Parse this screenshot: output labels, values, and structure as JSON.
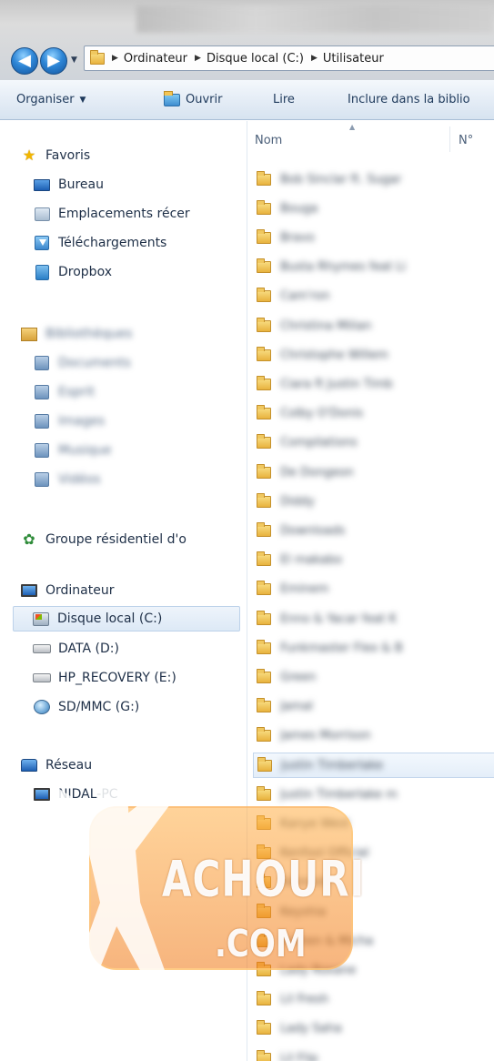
{
  "address_bar": {
    "crumbs": [
      "Ordinateur",
      "Disque local (C:)",
      "Utilisateur"
    ]
  },
  "toolbar": {
    "organiser": "Organiser",
    "open": "Ouvrir",
    "read": "Lire",
    "include": "Inclure dans la biblio"
  },
  "nav": {
    "favorites": {
      "label": "Favoris",
      "items": [
        "Bureau",
        "Emplacements récer",
        "Téléchargements",
        "Dropbox"
      ]
    },
    "libraries": {
      "label": "Bibliothèques",
      "items": [
        "Documents",
        "Esprit",
        "Images",
        "Musique",
        "Vidéos"
      ]
    },
    "homegroup": "Groupe résidentiel d'o",
    "computer": {
      "label": "Ordinateur",
      "items": [
        "Disque local (C:)",
        "DATA (D:)",
        "HP_RECOVERY (E:)",
        "SD/MMC (G:)"
      ]
    },
    "network": {
      "label": "Réseau",
      "items": [
        "NIDAL-PC"
      ]
    }
  },
  "content": {
    "columns": [
      "Nom",
      "N°"
    ],
    "folders": [
      "Bob Sinclar ft. Sugar",
      "Bouga",
      "Bravo",
      "Busta Rhymes feat Li",
      "Cam'ron",
      "Christina Milian",
      "Christophe Willem",
      "Ciara ft Justin Timb",
      "Colby O'Donis",
      "Compilations",
      "De Dongeon",
      "Diddy",
      "Downloads",
      "El makabo",
      "Eminem",
      "Enno & Yacar feat K",
      "Funkmaster Flex & B",
      "Green",
      "Jamal",
      "James Morrison",
      "Justin Timberlake",
      "Justin Timberlake m",
      "Kanye West",
      "Kenfool Official",
      "Kennedy",
      "Keyshia",
      "Kristen & Micha",
      "Lady Roxane",
      "Lil Fresh",
      "Lady Saha",
      "Lil Flip"
    ],
    "selected_index": 20
  },
  "watermark": {
    "text": "ACHOURI",
    "sub": ".COM"
  }
}
